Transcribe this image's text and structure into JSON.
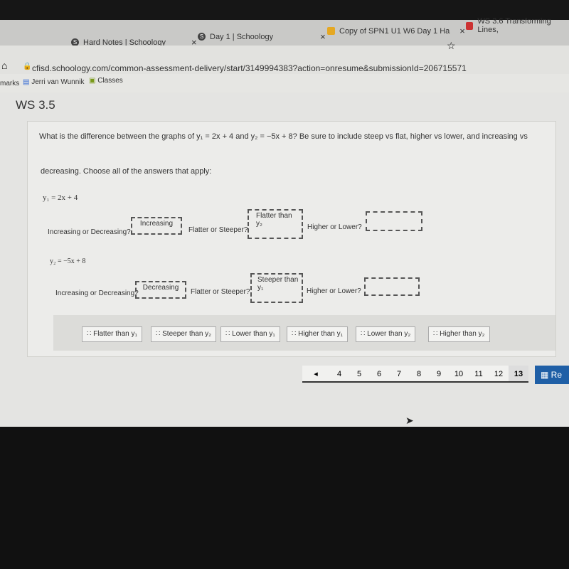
{
  "browser": {
    "tabs": [
      {
        "label": "Hard Notes | Schoology"
      },
      {
        "label": "Day 1 | Schoology"
      },
      {
        "label": "Copy of SPN1 U1 W6 Day 1 Ha"
      },
      {
        "label": "WS 3.6 Transforming Lines,"
      }
    ],
    "url": "cfisd.schoology.com/common-assessment-delivery/start/3149994383?action=onresume&submissionId=206715571",
    "bookmarks": [
      "marks",
      "Jerri van Wunnik",
      "Classes"
    ]
  },
  "page": {
    "title": "WS 3.5",
    "question_line1": "What is the difference between the graphs of y₁ = 2x + 4 and y₂ = −5x + 8? Be sure to include steep vs flat, higher vs lower, and increasing vs",
    "question_line2": "decreasing. Choose all of the answers that apply:",
    "eq1": "y₁ = 2x + 4",
    "eq2": "y₂ = −5x + 8",
    "labels": {
      "inc": "Increasing or Decreasing?",
      "flat": "Flatter or Steeper?",
      "high": "Higher or Lower?"
    },
    "row1": {
      "inc": "Increasing",
      "flat": "Flatter than y₂",
      "high": ""
    },
    "row2": {
      "inc": "Decreasing",
      "flat": "Steeper than y₁",
      "high": ""
    },
    "bank": [
      "Flatter than y₁",
      "Steeper than y₂",
      "Lower than y₁",
      "Higher than y₁",
      "Lower than y₂",
      "Higher than y₂"
    ],
    "pager": {
      "pages": [
        "4",
        "5",
        "6",
        "7",
        "8",
        "9",
        "10",
        "11",
        "12",
        "13"
      ],
      "current": "13",
      "review": "Re"
    }
  }
}
